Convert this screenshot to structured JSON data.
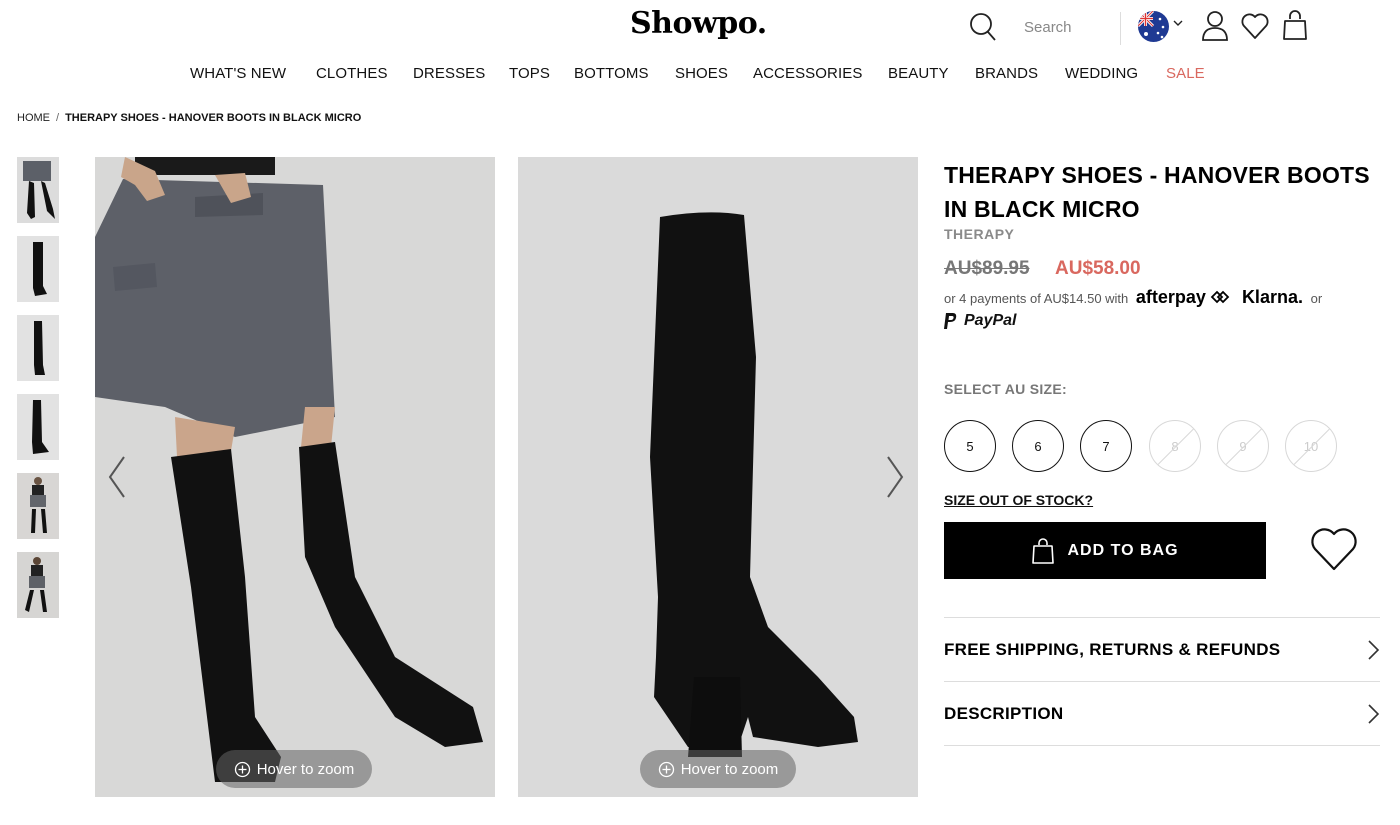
{
  "header": {
    "logo": "Showpo.",
    "search_placeholder": "Search"
  },
  "nav": [
    {
      "label": "WHAT'S NEW"
    },
    {
      "label": "CLOTHES"
    },
    {
      "label": "DRESSES"
    },
    {
      "label": "TOPS"
    },
    {
      "label": "BOTTOMS"
    },
    {
      "label": "SHOES"
    },
    {
      "label": "ACCESSORIES"
    },
    {
      "label": "BEAUTY"
    },
    {
      "label": "BRANDS"
    },
    {
      "label": "WEDDING"
    },
    {
      "label": "SALE"
    }
  ],
  "breadcrumb": {
    "home": "HOME",
    "separator": "/",
    "current": "THERAPY SHOES - HANOVER BOOTS IN BLACK MICRO"
  },
  "gallery": {
    "zoom_label": "Hover to zoom"
  },
  "product": {
    "title": "THERAPY SHOES - HANOVER BOOTS IN BLACK MICRO",
    "brand": "THERAPY",
    "price_old": "AU$89.95",
    "price_new": "AU$58.00",
    "payments_prefix": "or 4 payments of AU$14.50 with",
    "afterpay": "afterpay",
    "klarna": "Klarna.",
    "or": "or",
    "paypal": "PayPal",
    "size_label": "SELECT AU SIZE:",
    "sizes": [
      {
        "label": "5",
        "available": true
      },
      {
        "label": "6",
        "available": true
      },
      {
        "label": "7",
        "available": true
      },
      {
        "label": "8",
        "available": false
      },
      {
        "label": "9",
        "available": false
      },
      {
        "label": "10",
        "available": false
      }
    ],
    "oos_link": "SIZE OUT OF STOCK?",
    "add_to_bag": "ADD TO BAG"
  },
  "accordion": [
    {
      "label": "FREE SHIPPING, RETURNS & REFUNDS"
    },
    {
      "label": "DESCRIPTION"
    }
  ],
  "colors": {
    "sale": "#d9685f",
    "button": "#000000"
  }
}
